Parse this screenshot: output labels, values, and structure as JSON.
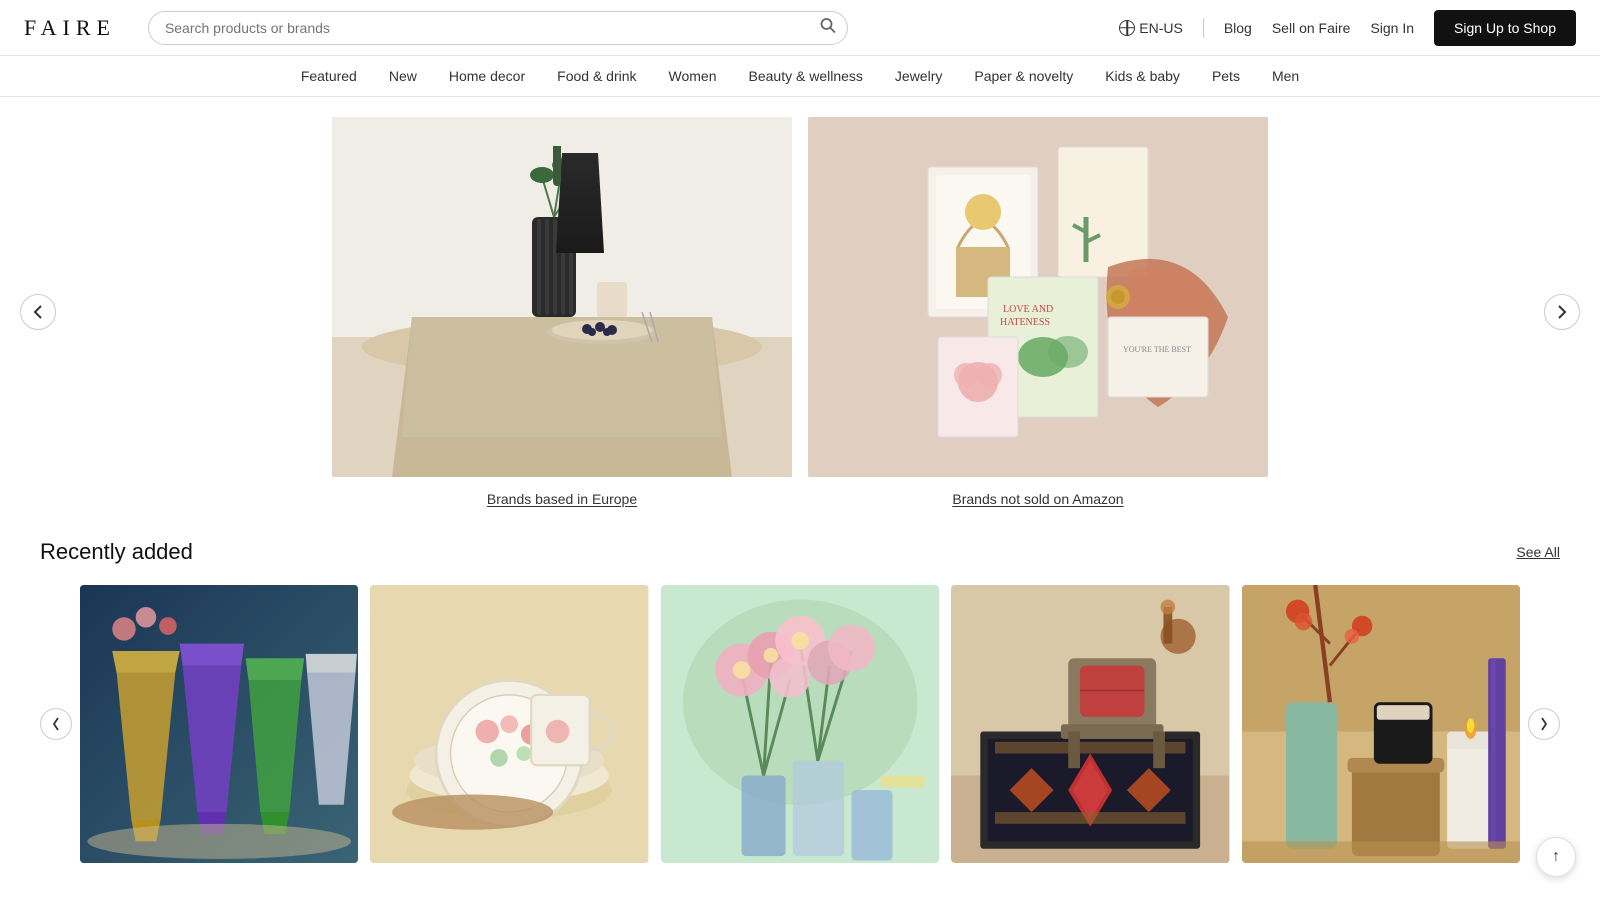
{
  "header": {
    "logo": "FAIRE",
    "search_placeholder": "Search products or brands",
    "lang": "EN-US",
    "nav_links": [
      {
        "label": "Blog",
        "name": "blog-link"
      },
      {
        "label": "Sell on Faire",
        "name": "sell-link"
      },
      {
        "label": "Sign In",
        "name": "signin-link"
      }
    ],
    "cta": "Sign Up to Shop"
  },
  "nav": {
    "items": [
      {
        "label": "Featured",
        "name": "nav-featured"
      },
      {
        "label": "New",
        "name": "nav-new"
      },
      {
        "label": "Home decor",
        "name": "nav-home-decor"
      },
      {
        "label": "Food & drink",
        "name": "nav-food-drink"
      },
      {
        "label": "Women",
        "name": "nav-women"
      },
      {
        "label": "Beauty & wellness",
        "name": "nav-beauty"
      },
      {
        "label": "Jewelry",
        "name": "nav-jewelry"
      },
      {
        "label": "Paper & novelty",
        "name": "nav-paper"
      },
      {
        "label": "Kids & baby",
        "name": "nav-kids"
      },
      {
        "label": "Pets",
        "name": "nav-pets"
      },
      {
        "label": "Men",
        "name": "nav-men"
      }
    ]
  },
  "featured": {
    "prev_label": "‹",
    "next_label": "›",
    "items": [
      {
        "label": "Brands based in Europe",
        "alt": "Linen tablecloth with vase and blueberries",
        "name": "featured-europe"
      },
      {
        "label": "Brands not sold on Amazon",
        "alt": "Colorful greeting cards and accessories collage",
        "name": "featured-amazon"
      }
    ]
  },
  "recently_added": {
    "title": "Recently added",
    "see_all": "See All",
    "prev_label": "‹",
    "next_label": "›",
    "products": [
      {
        "alt": "Colorful stemmed glasses on table",
        "name": "product-glasses"
      },
      {
        "alt": "Floral porcelain plates and mugs",
        "name": "product-plates"
      },
      {
        "alt": "Pink flowers arrangement",
        "name": "product-flowers"
      },
      {
        "alt": "Kilim rug with chair and decor",
        "name": "product-rug"
      },
      {
        "alt": "Candles and home fragrance products",
        "name": "product-candles"
      }
    ]
  },
  "scroll_top": "↑"
}
